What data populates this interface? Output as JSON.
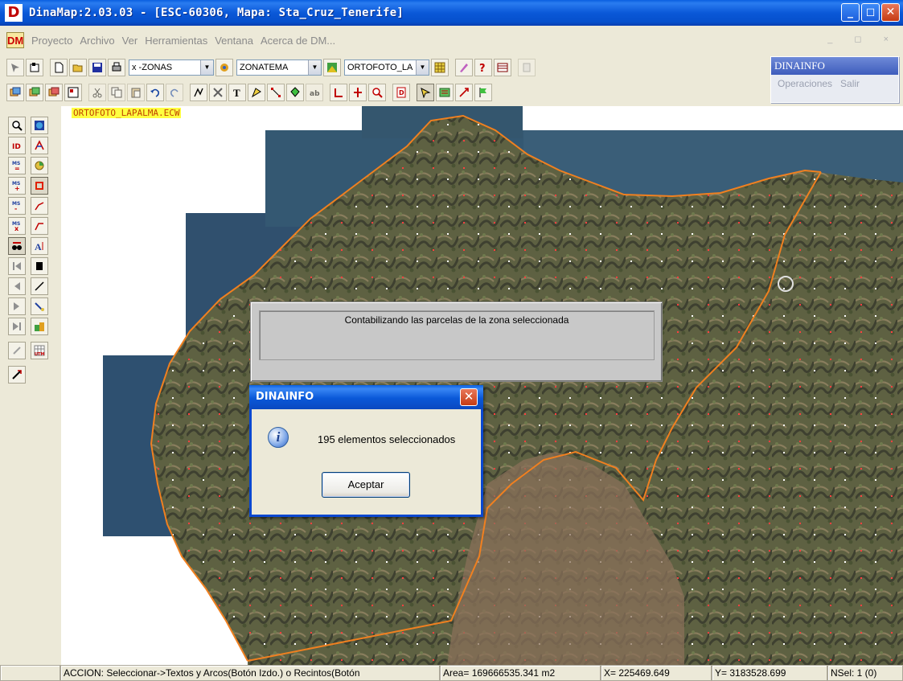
{
  "window": {
    "title": "DinaMap:2.03.03 - [ESC-60306, Mapa: Sta_Cruz_Tenerife]",
    "app_icon_letter": "D",
    "min_glyph": "_",
    "max_glyph": "◻",
    "close_glyph": "✕"
  },
  "menubar": {
    "icon_text": "DM",
    "items": [
      "Proyecto",
      "Archivo",
      "Ver",
      "Herramientas",
      "Ventana",
      "Acerca de DM..."
    ],
    "mdi_controls": "_ ◻ ×"
  },
  "toolbar": {
    "zones_combo": "x -ZONAS",
    "theme_combo": "ZONATEMA",
    "layer_combo": "ORTOFOTO_LA"
  },
  "dinainfo_panel": {
    "title": "DINAINFO",
    "menu": [
      "Operaciones",
      "Salir"
    ]
  },
  "map": {
    "layer_label": "ORTOFOTO_LAPALMA.ECW"
  },
  "progress_dialog": {
    "message": "Contabilizando las parcelas de la zona seleccionada"
  },
  "message_box": {
    "title": "DINAINFO",
    "close_glyph": "✕",
    "icon_glyph": "i",
    "text": "195 elementos seleccionados",
    "ok_label": "Aceptar"
  },
  "statusbar": {
    "action": "ACCION: Seleccionar->Textos y Arcos(Botón Izdo.) o Recintos(Botón",
    "area": "Area= 169666535.341 m2",
    "x": "X= 225469.649",
    "y": "Y= 3183528.699",
    "nsel": "NSel: 1 (0)"
  }
}
